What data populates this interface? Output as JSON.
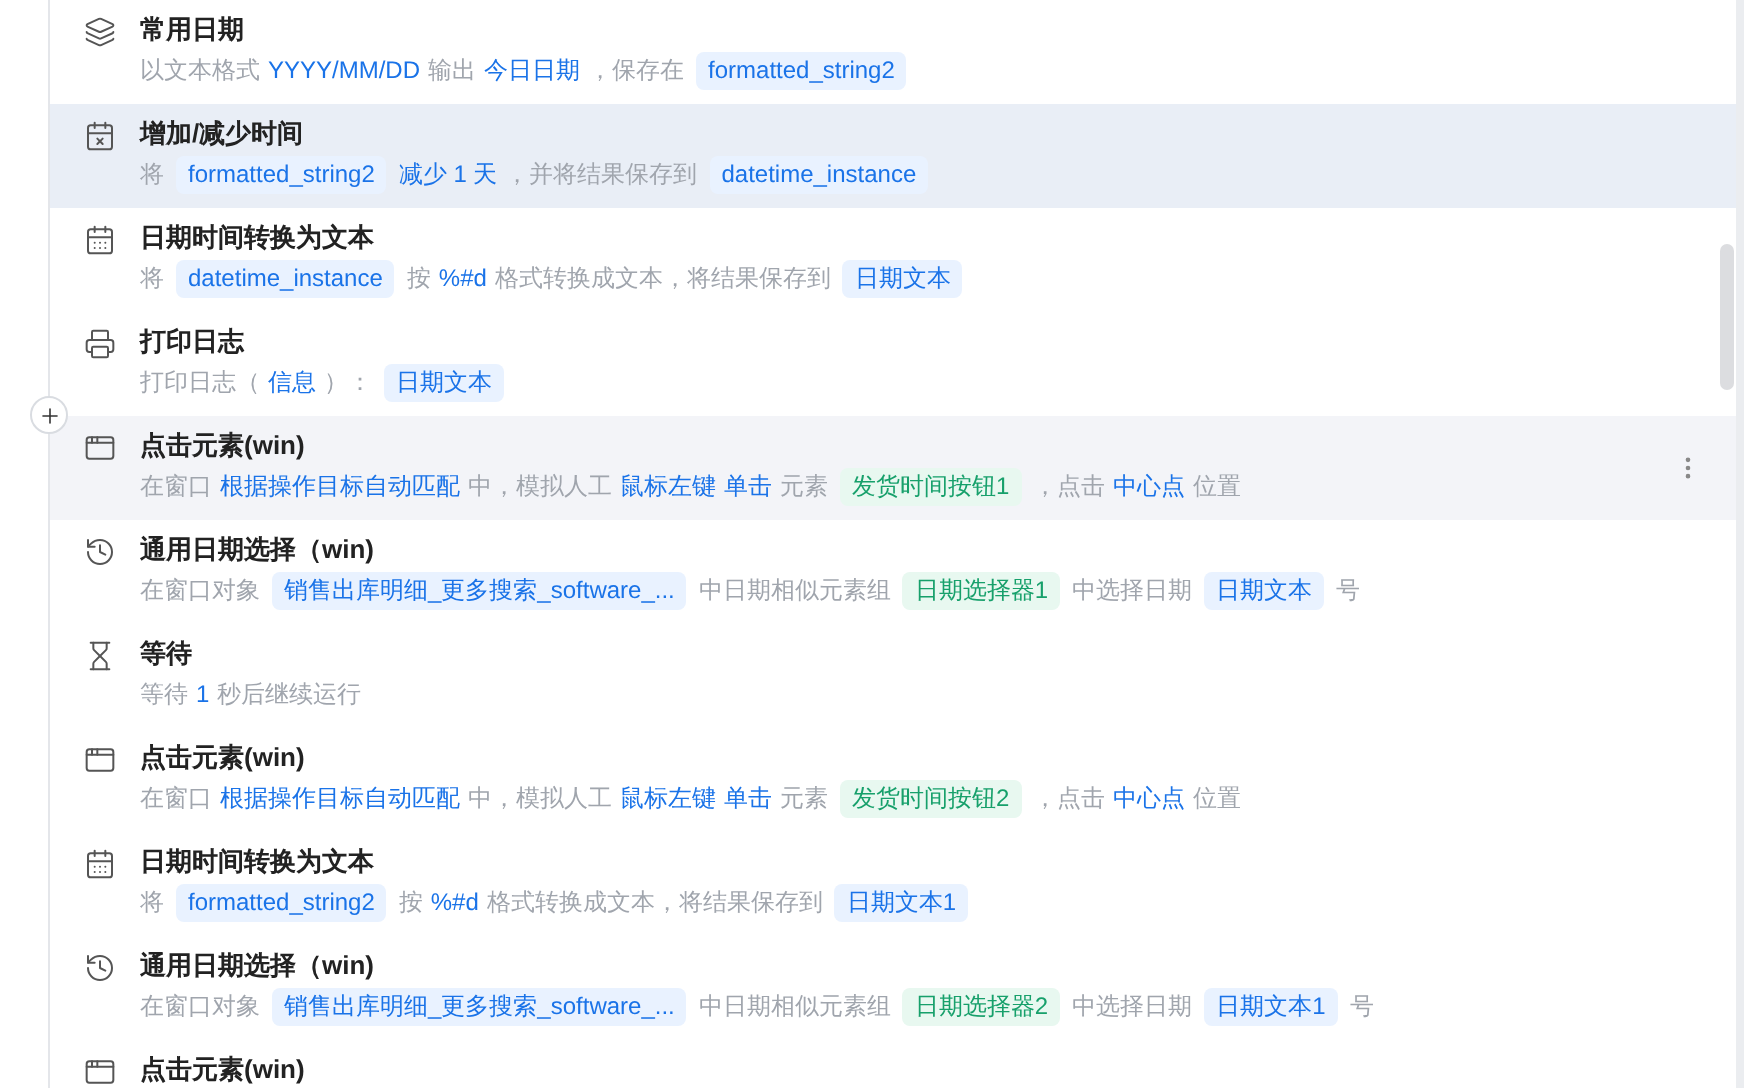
{
  "steps": [
    {
      "kind": "layers",
      "title": "常用日期",
      "selected": false,
      "hovered": false,
      "description": [
        {
          "kind": "text",
          "text": "以文本格式"
        },
        {
          "kind": "value",
          "text": "YYYY/MM/DD"
        },
        {
          "kind": "text",
          "text": "输出"
        },
        {
          "kind": "value",
          "text": "今日日期"
        },
        {
          "kind": "text",
          "text": "，保存在"
        },
        {
          "kind": "var",
          "text": "formatted_string2"
        }
      ]
    },
    {
      "kind": "calendar-alert",
      "title": "增加/减少时间",
      "selected": true,
      "hovered": false,
      "description": [
        {
          "kind": "text",
          "text": "将"
        },
        {
          "kind": "var",
          "text": "formatted_string2"
        },
        {
          "kind": "value",
          "text": "减少 1 天"
        },
        {
          "kind": "text",
          "text": "，并将结果保存到"
        },
        {
          "kind": "var",
          "text": "datetime_instance"
        }
      ]
    },
    {
      "kind": "calendar",
      "title": "日期时间转换为文本",
      "selected": false,
      "hovered": false,
      "description": [
        {
          "kind": "text",
          "text": "将"
        },
        {
          "kind": "var",
          "text": "datetime_instance"
        },
        {
          "kind": "text",
          "text": "按"
        },
        {
          "kind": "value",
          "text": "%#d"
        },
        {
          "kind": "text",
          "text": "格式转换成文本，将结果保存到"
        },
        {
          "kind": "var",
          "text": "日期文本"
        }
      ]
    },
    {
      "kind": "printer",
      "title": "打印日志",
      "selected": false,
      "hovered": false,
      "description": [
        {
          "kind": "text",
          "text": "打印日志（"
        },
        {
          "kind": "value",
          "text": "信息"
        },
        {
          "kind": "text",
          "text": "）："
        },
        {
          "kind": "var",
          "text": "日期文本"
        }
      ]
    },
    {
      "kind": "click",
      "title": "点击元素(win)",
      "selected": false,
      "hovered": true,
      "description": [
        {
          "kind": "text",
          "text": "在窗口"
        },
        {
          "kind": "value",
          "text": "根据操作目标自动匹配"
        },
        {
          "kind": "text",
          "text": "中，模拟人工"
        },
        {
          "kind": "value",
          "text": "鼠标左键"
        },
        {
          "kind": "value",
          "text": "单击"
        },
        {
          "kind": "text",
          "text": "元素"
        },
        {
          "kind": "element",
          "text": "发货时间按钮1"
        },
        {
          "kind": "text",
          "text": "，点击"
        },
        {
          "kind": "value",
          "text": "中心点"
        },
        {
          "kind": "text",
          "text": "位置"
        }
      ]
    },
    {
      "kind": "history",
      "title": "通用日期选择（win)",
      "selected": false,
      "hovered": false,
      "description": [
        {
          "kind": "text",
          "text": "在窗口对象"
        },
        {
          "kind": "var",
          "text": "销售出库明细_更多搜索_software_..."
        },
        {
          "kind": "text",
          "text": "中日期相似元素组"
        },
        {
          "kind": "element",
          "text": "日期选择器1"
        },
        {
          "kind": "text",
          "text": "中选择日期"
        },
        {
          "kind": "var",
          "text": "日期文本"
        },
        {
          "kind": "text",
          "text": "号"
        }
      ]
    },
    {
      "kind": "hourglass",
      "title": "等待",
      "selected": false,
      "hovered": false,
      "description": [
        {
          "kind": "text",
          "text": "等待"
        },
        {
          "kind": "value",
          "text": "1"
        },
        {
          "kind": "text",
          "text": "秒后继续运行"
        }
      ]
    },
    {
      "kind": "click",
      "title": "点击元素(win)",
      "selected": false,
      "hovered": false,
      "description": [
        {
          "kind": "text",
          "text": "在窗口"
        },
        {
          "kind": "value",
          "text": "根据操作目标自动匹配"
        },
        {
          "kind": "text",
          "text": "中，模拟人工"
        },
        {
          "kind": "value",
          "text": "鼠标左键"
        },
        {
          "kind": "value",
          "text": "单击"
        },
        {
          "kind": "text",
          "text": "元素"
        },
        {
          "kind": "element",
          "text": "发货时间按钮2"
        },
        {
          "kind": "text",
          "text": "，点击"
        },
        {
          "kind": "value",
          "text": "中心点"
        },
        {
          "kind": "text",
          "text": "位置"
        }
      ]
    },
    {
      "kind": "calendar",
      "title": "日期时间转换为文本",
      "selected": false,
      "hovered": false,
      "description": [
        {
          "kind": "text",
          "text": "将"
        },
        {
          "kind": "var",
          "text": "formatted_string2"
        },
        {
          "kind": "text",
          "text": "按"
        },
        {
          "kind": "value",
          "text": "%#d"
        },
        {
          "kind": "text",
          "text": "格式转换成文本，将结果保存到"
        },
        {
          "kind": "var",
          "text": "日期文本1"
        }
      ]
    },
    {
      "kind": "history",
      "title": "通用日期选择（win)",
      "selected": false,
      "hovered": false,
      "description": [
        {
          "kind": "text",
          "text": "在窗口对象"
        },
        {
          "kind": "var",
          "text": "销售出库明细_更多搜索_software_..."
        },
        {
          "kind": "text",
          "text": "中日期相似元素组"
        },
        {
          "kind": "element",
          "text": "日期选择器2"
        },
        {
          "kind": "text",
          "text": "中选择日期"
        },
        {
          "kind": "var",
          "text": "日期文本1"
        },
        {
          "kind": "text",
          "text": "号"
        }
      ]
    },
    {
      "kind": "click",
      "title": "点击元素(win)",
      "selected": false,
      "hovered": false
    }
  ]
}
